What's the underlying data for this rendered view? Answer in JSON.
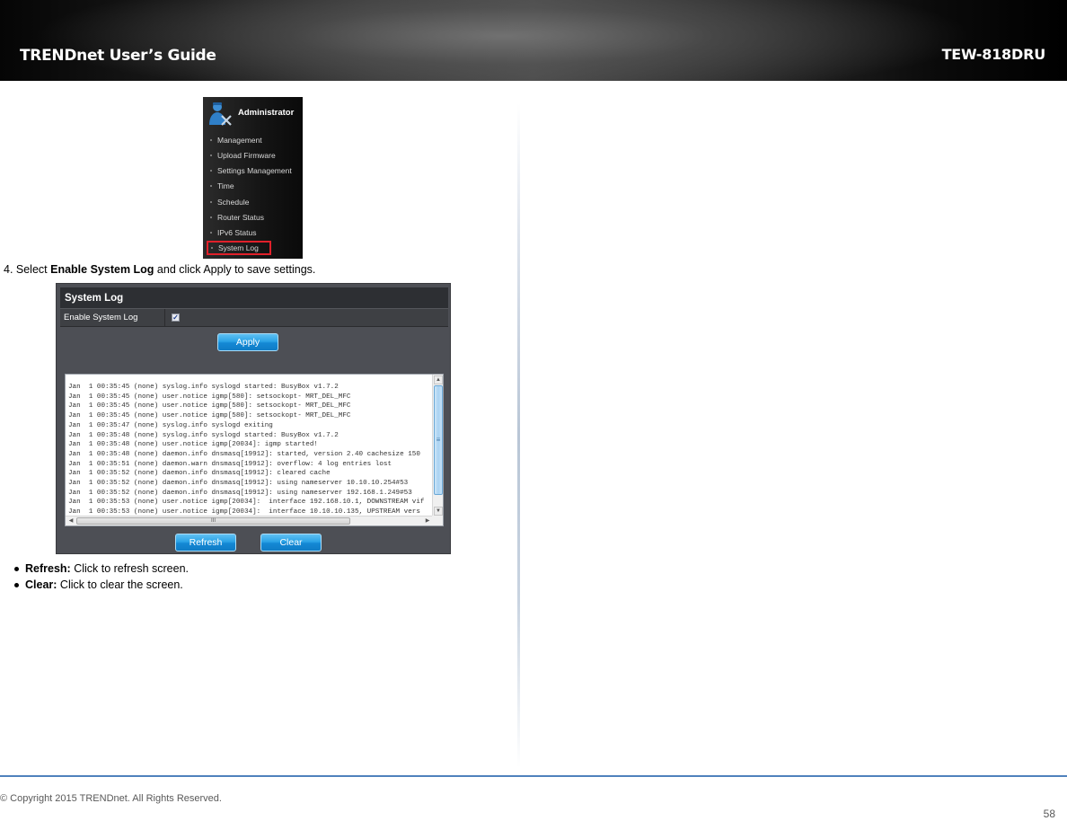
{
  "header": {
    "title": "TRENDnet User’s Guide",
    "model": "TEW-818DRU"
  },
  "admin_menu": {
    "title": "Administrator",
    "icon": "admin-user-tools-icon",
    "items": [
      {
        "label": "Management",
        "selected": false
      },
      {
        "label": "Upload Firmware",
        "selected": false
      },
      {
        "label": "Settings Management",
        "selected": false
      },
      {
        "label": "Time",
        "selected": false
      },
      {
        "label": "Schedule",
        "selected": false
      },
      {
        "label": "Router Status",
        "selected": false
      },
      {
        "label": "IPv6 Status",
        "selected": false
      },
      {
        "label": "System Log",
        "selected": true
      }
    ],
    "highlight_color": "#e0202a"
  },
  "step": {
    "prefix": "4. Select ",
    "bold": "Enable System Log",
    "suffix": " and click Apply to save settings."
  },
  "syslog_panel": {
    "title": "System Log",
    "enable_label": "Enable System Log",
    "enable_checked": true,
    "checkbox_glyph": "✓",
    "apply_label": "Apply",
    "refresh_label": "Refresh",
    "clear_label": "Clear",
    "button_color": "#1e96dc",
    "log_lines": [
      "Jan  1 00:35:45 (none) syslog.info syslogd started: BusyBox v1.7.2",
      "Jan  1 00:35:45 (none) user.notice igmp[580]: setsockopt- MRT_DEL_MFC",
      "Jan  1 00:35:45 (none) user.notice igmp[580]: setsockopt- MRT_DEL_MFC",
      "Jan  1 00:35:45 (none) user.notice igmp[580]: setsockopt- MRT_DEL_MFC",
      "Jan  1 00:35:47 (none) syslog.info syslogd exiting",
      "Jan  1 00:35:48 (none) syslog.info syslogd started: BusyBox v1.7.2",
      "Jan  1 00:35:48 (none) user.notice igmp[20034]: igmp started!",
      "Jan  1 00:35:48 (none) daemon.info dnsmasq[19912]: started, version 2.40 cachesize 150",
      "Jan  1 00:35:51 (none) daemon.warn dnsmasq[19912]: overflow: 4 log entries lost",
      "Jan  1 00:35:52 (none) daemon.info dnsmasq[19912]: cleared cache",
      "Jan  1 00:35:52 (none) daemon.info dnsmasq[19912]: using nameserver 10.10.10.254#53",
      "Jan  1 00:35:52 (none) daemon.info dnsmasq[19912]: using nameserver 192.168.1.249#53",
      "Jan  1 00:35:53 (none) user.notice igmp[20034]:  interface 192.168.10.1, DOWNSTREAM vif",
      "Jan  1 00:35:53 (none) user.notice igmp[20034]:  interface 10.10.10.135, UPSTREAM vers"
    ],
    "scroll_glyphs": {
      "up": "▲",
      "down": "▼",
      "left": "◀",
      "right": "▶",
      "grip": "≡",
      "hgrip": "III"
    }
  },
  "bullets": [
    {
      "bold": "Refresh:",
      "text": " Click to refresh screen."
    },
    {
      "bold": "Clear:",
      "text": " Click to clear the screen."
    }
  ],
  "footer": {
    "copyright": "© Copyright 2015 TRENDnet. All Rights Reserved.",
    "page_number": "58",
    "rule_color": "#4f81bd"
  }
}
